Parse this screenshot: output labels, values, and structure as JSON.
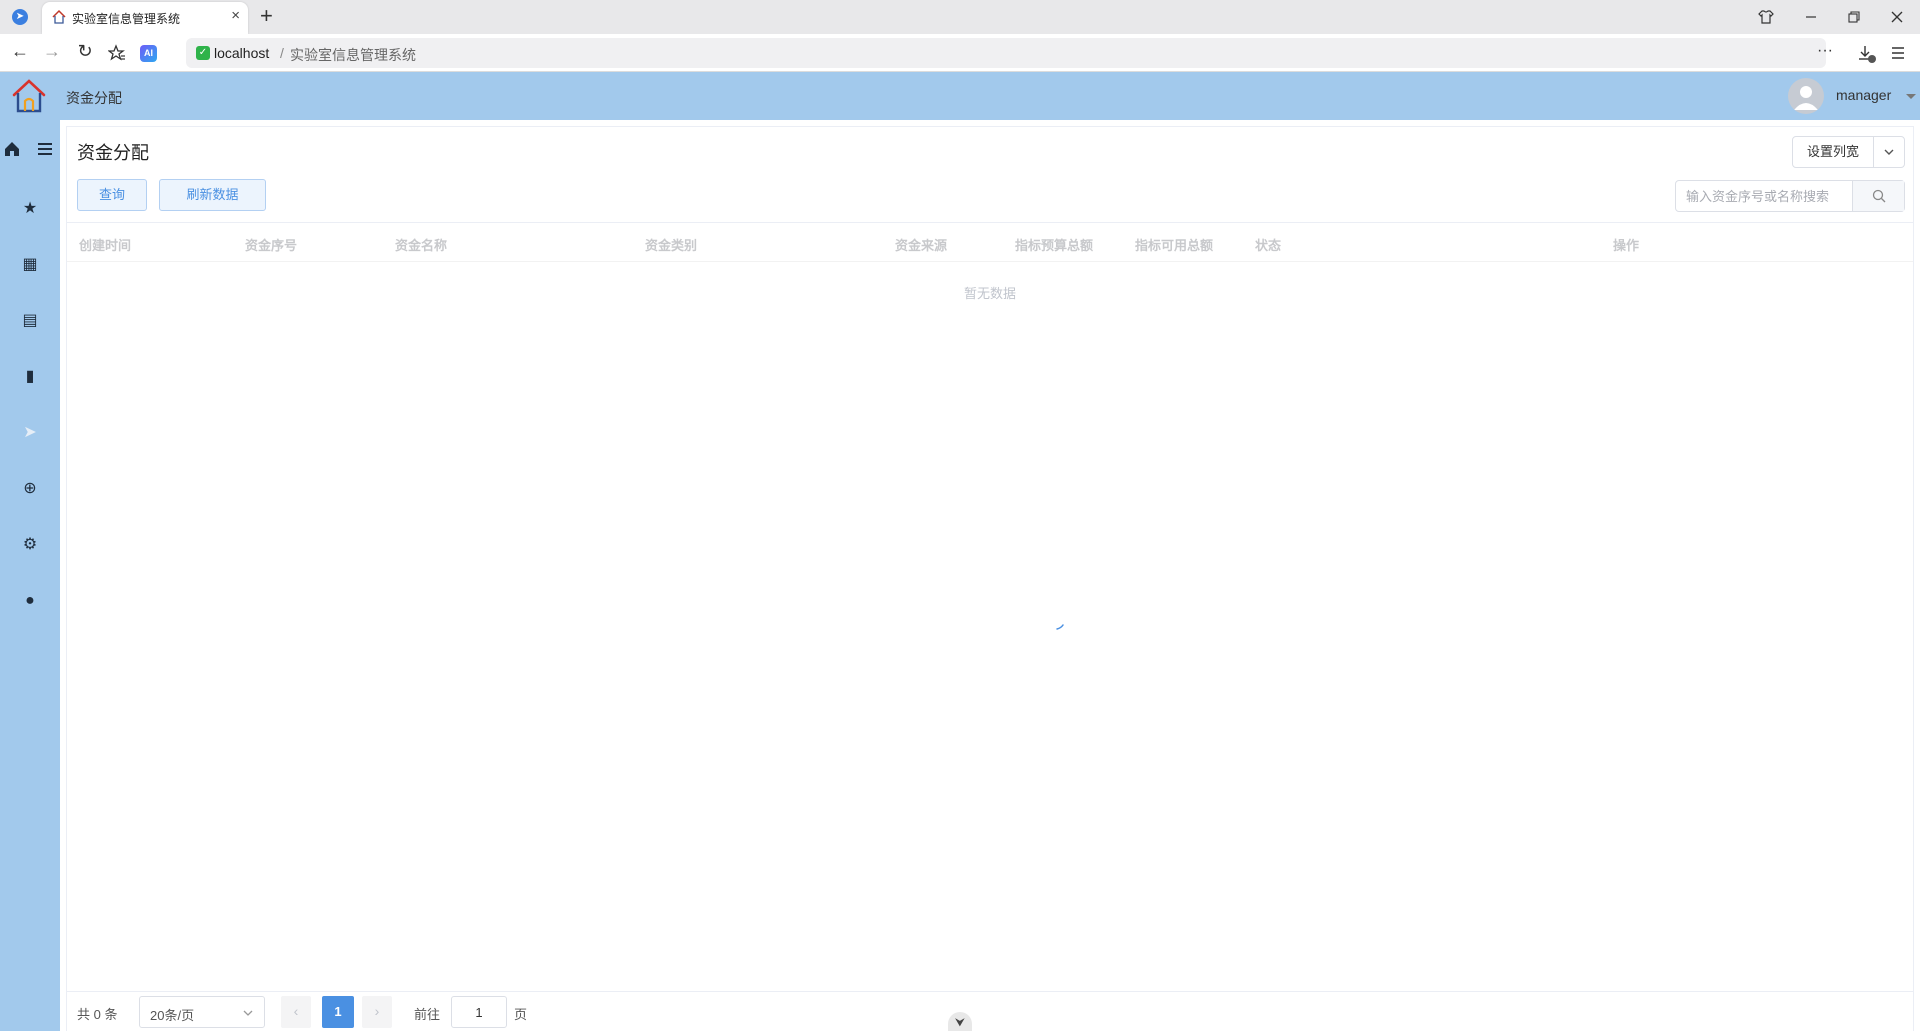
{
  "browser": {
    "tab_title": "实验室信息管理系统",
    "tab_close": "×",
    "new_tab": "+",
    "url_host": "localhost",
    "url_sep": "/",
    "url_path": "实验室信息管理系统",
    "back": "←",
    "forward": "→",
    "reload": "↻",
    "more": "···",
    "ai_label": "AI"
  },
  "header": {
    "title": "资金分配",
    "username": "manager"
  },
  "sidebar": {
    "items": [
      {
        "name": "favorites-icon",
        "glyph": "★"
      },
      {
        "name": "dashboard-icon",
        "glyph": "▦"
      },
      {
        "name": "library-icon",
        "glyph": "▤"
      },
      {
        "name": "chart-icon",
        "glyph": "▮"
      },
      {
        "name": "send-icon",
        "glyph": "➤"
      },
      {
        "name": "circle-plus-icon",
        "glyph": "⊕"
      },
      {
        "name": "settings-icon",
        "glyph": "⚙"
      },
      {
        "name": "user-icon",
        "glyph": "●"
      }
    ]
  },
  "page": {
    "title": "资金分配",
    "col_width_btn": "设置列宽",
    "query_btn": "查询",
    "refresh_btn": "刷新数据",
    "search_placeholder": "输入资金序号或名称搜索"
  },
  "table": {
    "columns": [
      "创建时间",
      "资金序号",
      "资金名称",
      "资金类别",
      "资金来源",
      "指标预算总额",
      "指标可用总额",
      "状态",
      "操作"
    ],
    "empty_text": "暂无数据"
  },
  "pagination": {
    "total": "共 0 条",
    "page_size": "20条/页",
    "prev": "‹",
    "next": "›",
    "current_page": "1",
    "goto_label": "前往",
    "goto_value": "1",
    "page_unit": "页"
  },
  "colors": {
    "header_bg": "#a2c9ec",
    "accent": "#4a90e2"
  }
}
